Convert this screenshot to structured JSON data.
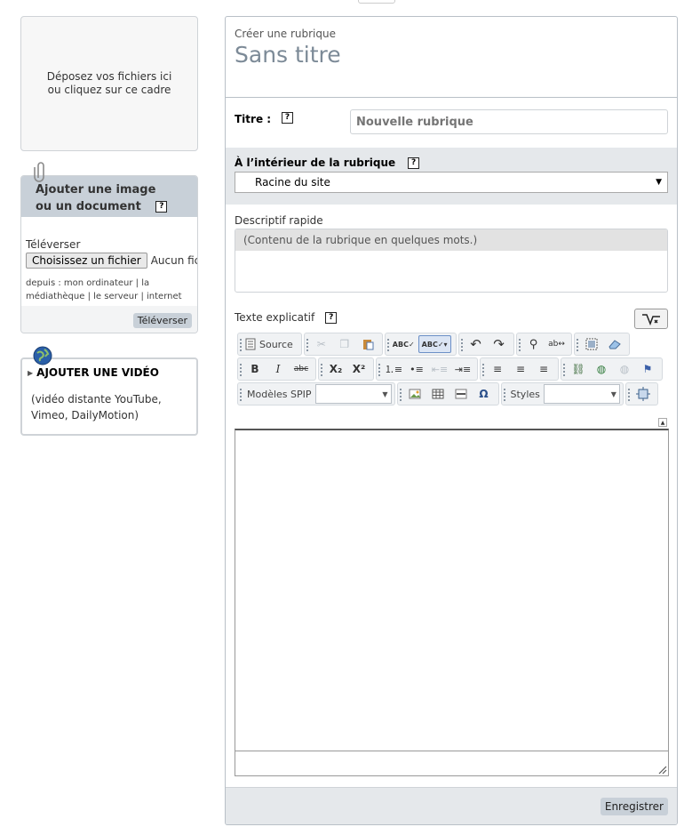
{
  "dropzone": {
    "line1": "Déposez vos fichiers ici",
    "line2": "ou cliquez sur ce cadre"
  },
  "documents": {
    "title_line1": "Ajouter une image",
    "title_line2": "ou un document",
    "help": "?",
    "upload_label": "Téléverser",
    "choose_file": "Choisissez un fichier",
    "no_file": "Aucun fichier choisi",
    "from_label": "depuis :",
    "from_computer": "mon ordinateur",
    "from_library": "la médiathèque",
    "from_server": "le serveur",
    "from_internet": "internet",
    "separator": "|",
    "upload_button": "Téléverser"
  },
  "video": {
    "title": "AJOUTER UNE VIDÉO",
    "desc_line1": "(vidéo distante YouTube,",
    "desc_line2": "Vimeo, DailyMotion)"
  },
  "form": {
    "subtitle": "Créer une rubrique",
    "title": "Sans titre",
    "titre_label": "Titre :",
    "titre_placeholder": "Nouvelle rubrique",
    "parent_label": "À l’intérieur de la rubrique",
    "parent_value": "Racine du site",
    "desc_label": "Descriptif rapide",
    "desc_placeholder": "(Contenu de la rubrique en quelques mots.)",
    "texte_label": "Texte explicatif",
    "help": "?",
    "save_button": "Enregistrer"
  },
  "toolbar": {
    "source": "Source",
    "bold": "B",
    "italic": "I",
    "strike": "abc",
    "sub": "X₂",
    "sup": "X²",
    "models": "Modèles SPIP",
    "styles": "Styles",
    "omega": "Ω",
    "undo": "↶",
    "redo": "↷"
  }
}
